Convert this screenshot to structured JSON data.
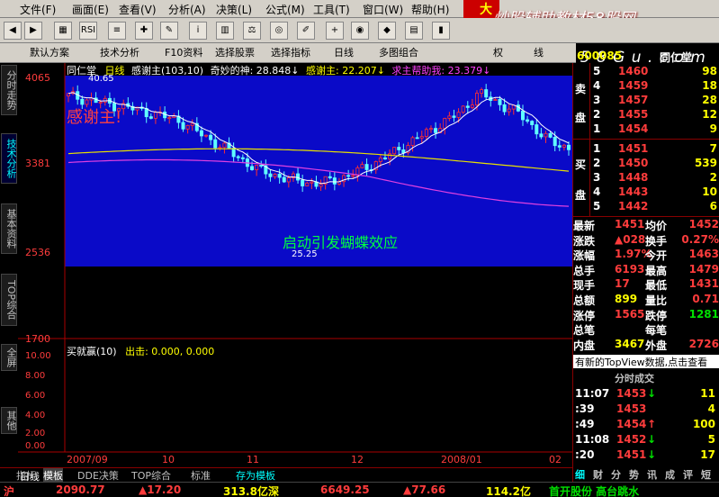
{
  "menu": {
    "items": [
      "文件(F)",
      "画面(E)",
      "查看(V)",
      "分析(A)",
      "决策(L)",
      "公式(M)",
      "工具(T)",
      "窗口(W)",
      "帮助(H)"
    ],
    "brand": "大智",
    "watermark": "炒股辅助教材58股网",
    "watermark_url": "w w w . 5 8 G u . c o m"
  },
  "toolbar": {
    "items": [
      "默认方案",
      "技术分析",
      "F10资料",
      "选择股票",
      "选择指标",
      "日线",
      "多图组合",
      "权",
      "线"
    ]
  },
  "left_tabs": [
    "分时走势",
    "技术分析",
    "基本资料",
    "TOP综合",
    "全屏",
    "其他"
  ],
  "chart_header": {
    "name": "同仁堂",
    "period": "日线",
    "ind1": "感谢主(103,10)",
    "ind2": "奇妙的神: 28.848↓",
    "ind3": "感谢主: 22.207↓",
    "ind4": "求主帮助我: 23.379↓"
  },
  "price_axis": [
    "4065",
    "3381",
    "2536",
    "1700"
  ],
  "annotations": {
    "top_left": "感谢主!",
    "high": "40.65",
    "low": "25.25",
    "middle": "启动引发蝴蝶效应"
  },
  "sub_header": {
    "name": "买就赢(10)",
    "label": "出击: 0.000, 0.000"
  },
  "sub_axis": [
    "10.00",
    "8.00",
    "6.00",
    "4.00",
    "2.00",
    "0.00"
  ],
  "date_axis": [
    "2007/09",
    "10",
    "11",
    "12",
    "2008/01",
    "02"
  ],
  "bottom_tabs": [
    "日线",
    "指标",
    "模板",
    "DDE决策",
    "TOP综合",
    "标准",
    "存为模板"
  ],
  "chart_data": {
    "type": "candlestick",
    "overlays": [
      "white MA",
      "yellow MA",
      "magenta MA"
    ],
    "ylim": [
      17.0,
      40.65
    ],
    "high": 40.65,
    "low": 25.25
  },
  "quote": {
    "code": "600085",
    "name": "同仁堂",
    "asks": [
      {
        "lv": "5",
        "p": "1460",
        "v": "98"
      },
      {
        "lv": "4",
        "p": "1459",
        "v": "18"
      },
      {
        "lv": "3",
        "p": "1457",
        "v": "28"
      },
      {
        "lv": "2",
        "p": "1455",
        "v": "12"
      },
      {
        "lv": "1",
        "p": "1454",
        "v": "9"
      }
    ],
    "bids": [
      {
        "lv": "1",
        "p": "1451",
        "v": "7"
      },
      {
        "lv": "2",
        "p": "1450",
        "v": "539"
      },
      {
        "lv": "3",
        "p": "1448",
        "v": "2"
      },
      {
        "lv": "4",
        "p": "1443",
        "v": "10"
      },
      {
        "lv": "5",
        "p": "1442",
        "v": "6"
      }
    ],
    "ask_label": [
      "卖",
      "盘"
    ],
    "bid_label": [
      "买",
      "盘"
    ],
    "stats": [
      [
        "最新",
        "1451",
        "均价",
        "1452"
      ],
      [
        "涨跌",
        "▲028",
        "换手",
        "0.27%"
      ],
      [
        "涨幅",
        "1.97%",
        "今开",
        "1463"
      ],
      [
        "总手",
        "6193",
        "最高",
        "1479"
      ],
      [
        "现手",
        "17",
        "最低",
        "1431"
      ],
      [
        "总额",
        "899",
        "量比",
        "0.71"
      ],
      [
        "涨停",
        "1565",
        "跌停",
        "1281"
      ],
      [
        "总笔",
        "",
        "每笔",
        ""
      ],
      [
        "内盘",
        "3467",
        "外盘",
        "2726"
      ]
    ],
    "notice": "有新的TopView数据,点击查看",
    "trades_title": "分时成交",
    "trades": [
      [
        "11:07",
        "1453",
        "↓",
        "11"
      ],
      [
        ":39",
        "1453",
        "",
        "4"
      ],
      [
        ":49",
        "1454",
        "↑",
        "100"
      ],
      [
        "11:08",
        "1452",
        "↓",
        "5"
      ],
      [
        ":20",
        "1451",
        "↓",
        "17"
      ]
    ],
    "bottom_tabs": [
      "细",
      "财",
      "分",
      "势",
      "讯",
      "成",
      "评",
      "短"
    ]
  },
  "status": {
    "market": "沪",
    "index": "2090.77",
    "change": "▲17.20",
    "amount": "313.8亿深",
    "index2": "6649.25",
    "change2": "▲77.66",
    "amount2": "114.2亿",
    "news": "首开股份 高台跳水"
  }
}
